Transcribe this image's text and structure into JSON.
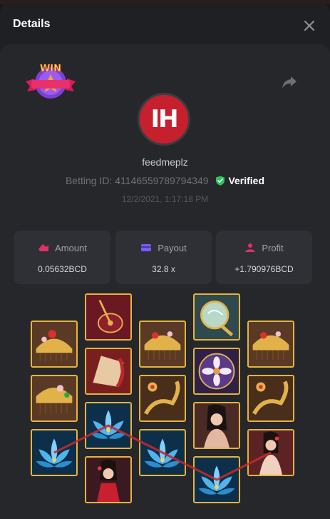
{
  "header": {
    "title": "Details"
  },
  "badge": {
    "label": "WIN"
  },
  "avatar": {
    "initials": "IH"
  },
  "player": {
    "username": "feedmeplz",
    "betting_id_label": "Betting ID: 41146559789794349",
    "verified_label": "Verified",
    "timestamp": "12/2/2021, 1:17:18 PM"
  },
  "stats": {
    "amount": {
      "label": "Amount",
      "value": "0.05632BCD"
    },
    "payout": {
      "label": "Payout",
      "value": "32.8 x"
    },
    "profit": {
      "label": "Profit",
      "value": "+1.790976BCD"
    }
  },
  "colors": {
    "accent_green": "#2ec15b",
    "tile_border": "#e5b53b",
    "payline": "#c22a2a",
    "amount_icon": "#e0306a",
    "payout_icon": "#7b5cf0",
    "profit_icon": "#e0306a"
  },
  "reels": [
    [
      "comb",
      "comb",
      "lotus"
    ],
    [
      "ruby",
      "fan",
      "lotus",
      "dancer"
    ],
    [
      "comb",
      "comb",
      "lotus"
    ],
    [
      "mirror",
      "flower",
      "lady",
      "lotus"
    ],
    [
      "comb",
      "comb",
      "lady"
    ]
  ]
}
